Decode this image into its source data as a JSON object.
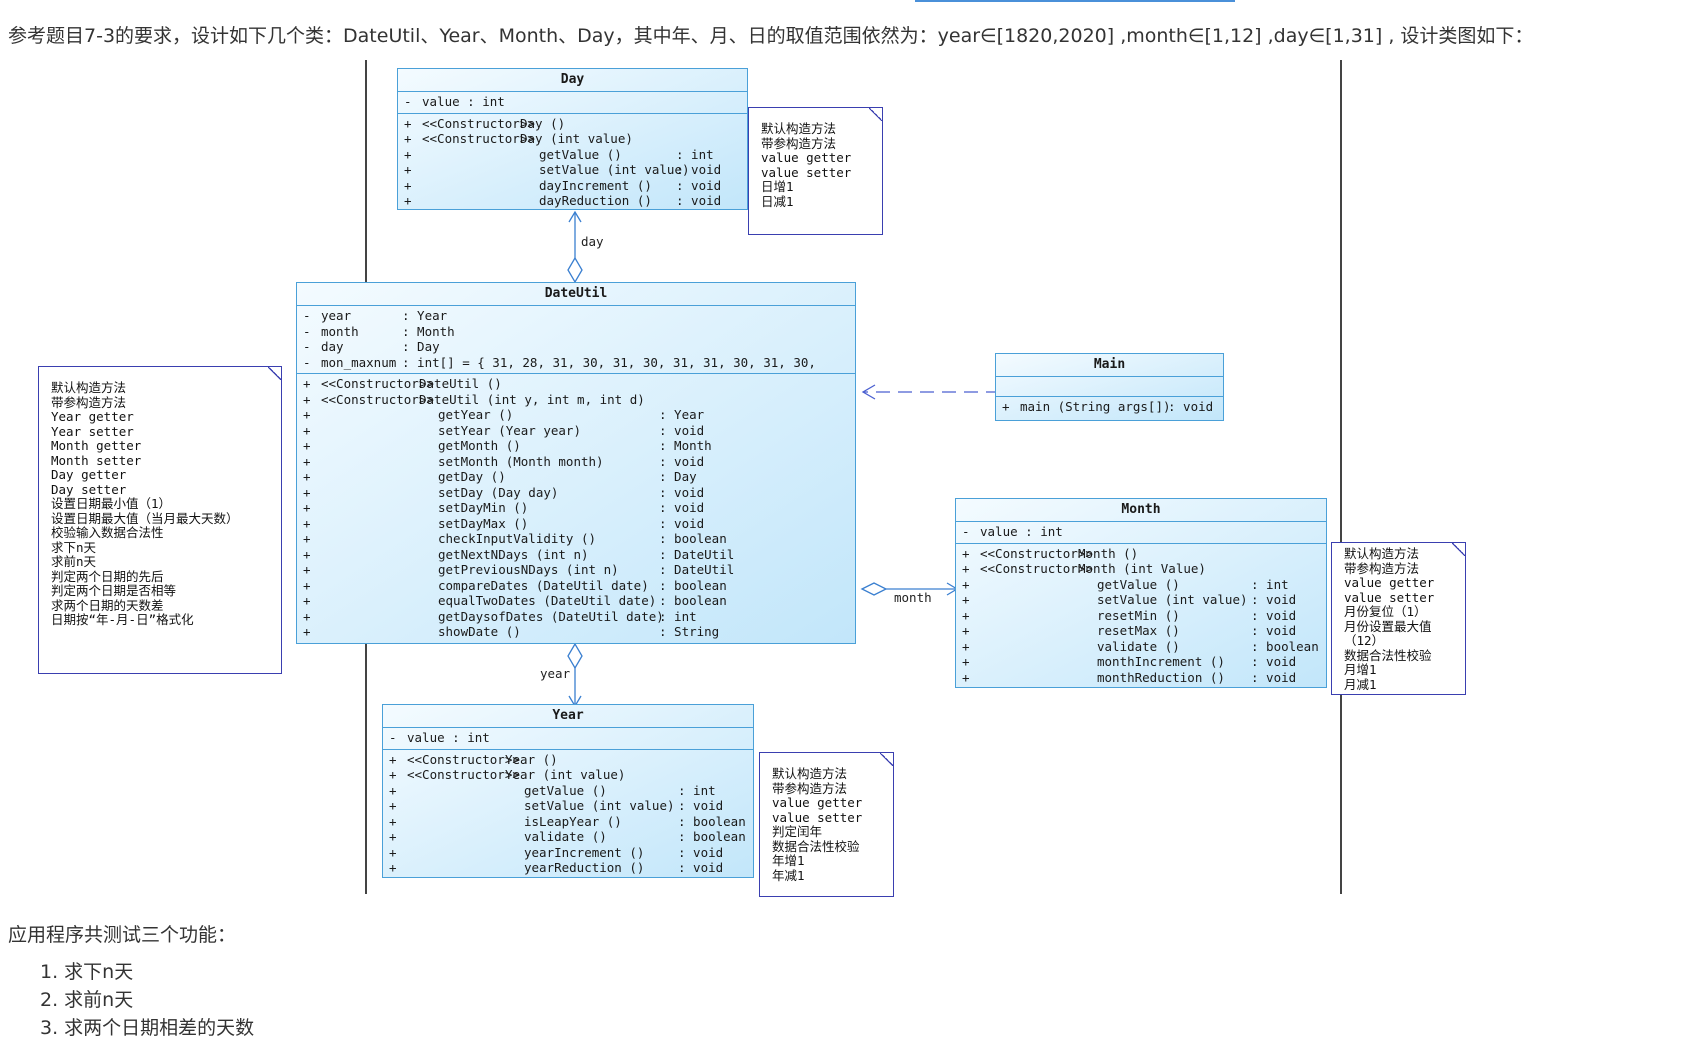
{
  "intro": "参考题目7-3的要求，设计如下几个类：DateUtil、Year、Month、Day，其中年、月、日的取值范围依然为：year∈[1820,2020] ,month∈[1,12] ,day∈[1,31] , 设计类图如下：",
  "classes": {
    "day": {
      "title": "Day",
      "attrs": [
        {
          "vis": "-",
          "name": "value : int"
        }
      ],
      "ops": [
        {
          "vis": "+",
          "stereo": "<<Constructor>>",
          "name": "Day ()",
          "type": ""
        },
        {
          "vis": "+",
          "stereo": "<<Constructor>>",
          "name": "Day (int value)",
          "type": ""
        },
        {
          "vis": "+",
          "stereo": "",
          "name": "getValue ()",
          "type": ": int"
        },
        {
          "vis": "+",
          "stereo": "",
          "name": "setValue (int value)",
          "type": ": void"
        },
        {
          "vis": "+",
          "stereo": "",
          "name": "dayIncrement ()",
          "type": ": void"
        },
        {
          "vis": "+",
          "stereo": "",
          "name": "dayReduction ()",
          "type": ": void"
        }
      ]
    },
    "dateutil": {
      "title": "DateUtil",
      "attrs": [
        {
          "vis": "-",
          "name": "year",
          "type": ": Year"
        },
        {
          "vis": "-",
          "name": "month",
          "type": ": Month"
        },
        {
          "vis": "-",
          "name": "day",
          "type": ": Day"
        },
        {
          "vis": "-",
          "name": "mon_maxnum",
          "type": ": int[] = { 31, 28, 31, 30, 31, 30, 31, 31, 30, 31, 30,"
        }
      ],
      "ops": [
        {
          "vis": "+",
          "stereo": "<<Constructor>>",
          "name": "DateUtil ()",
          "type": ""
        },
        {
          "vis": "+",
          "stereo": "<<Constructor>>",
          "name": "DateUtil (int y, int m, int d)",
          "type": ""
        },
        {
          "vis": "+",
          "stereo": "",
          "name": "getYear ()",
          "type": ": Year"
        },
        {
          "vis": "+",
          "stereo": "",
          "name": "setYear (Year year)",
          "type": ": void"
        },
        {
          "vis": "+",
          "stereo": "",
          "name": "getMonth ()",
          "type": ": Month"
        },
        {
          "vis": "+",
          "stereo": "",
          "name": "setMonth (Month month)",
          "type": ": void"
        },
        {
          "vis": "+",
          "stereo": "",
          "name": "getDay ()",
          "type": ": Day"
        },
        {
          "vis": "+",
          "stereo": "",
          "name": "setDay (Day day)",
          "type": ": void"
        },
        {
          "vis": "+",
          "stereo": "",
          "name": "setDayMin ()",
          "type": ": void"
        },
        {
          "vis": "+",
          "stereo": "",
          "name": "setDayMax ()",
          "type": ": void"
        },
        {
          "vis": "+",
          "stereo": "",
          "name": "checkInputValidity ()",
          "type": ": boolean"
        },
        {
          "vis": "+",
          "stereo": "",
          "name": "getNextNDays (int n)",
          "type": ": DateUtil"
        },
        {
          "vis": "+",
          "stereo": "",
          "name": "getPreviousNDays (int n)",
          "type": ": DateUtil"
        },
        {
          "vis": "+",
          "stereo": "",
          "name": "compareDates (DateUtil date)",
          "type": ": boolean"
        },
        {
          "vis": "+",
          "stereo": "",
          "name": "equalTwoDates (DateUtil date)",
          "type": ": boolean"
        },
        {
          "vis": "+",
          "stereo": "",
          "name": "getDaysofDates (DateUtil date)",
          "type": ": int"
        },
        {
          "vis": "+",
          "stereo": "",
          "name": "showDate ()",
          "type": ": String"
        }
      ]
    },
    "main": {
      "title": "Main",
      "attrs": [],
      "ops": [
        {
          "vis": "+",
          "stereo": "",
          "name": "main (String args[])",
          "type": ": void"
        }
      ]
    },
    "month": {
      "title": "Month",
      "attrs": [
        {
          "vis": "-",
          "name": "value : int"
        }
      ],
      "ops": [
        {
          "vis": "+",
          "stereo": "<<Constructor>>",
          "name": "Month ()",
          "type": ""
        },
        {
          "vis": "+",
          "stereo": "<<Constructor>>",
          "name": "Month (int Value)",
          "type": ""
        },
        {
          "vis": "+",
          "stereo": "",
          "name": "getValue ()",
          "type": ": int"
        },
        {
          "vis": "+",
          "stereo": "",
          "name": "setValue (int value)",
          "type": ": void"
        },
        {
          "vis": "+",
          "stereo": "",
          "name": "resetMin ()",
          "type": ": void"
        },
        {
          "vis": "+",
          "stereo": "",
          "name": "resetMax ()",
          "type": ": void"
        },
        {
          "vis": "+",
          "stereo": "",
          "name": "validate ()",
          "type": ": boolean"
        },
        {
          "vis": "+",
          "stereo": "",
          "name": "monthIncrement ()",
          "type": ": void"
        },
        {
          "vis": "+",
          "stereo": "",
          "name": "monthReduction ()",
          "type": ": void"
        }
      ]
    },
    "year": {
      "title": "Year",
      "attrs": [
        {
          "vis": "-",
          "name": "value : int"
        }
      ],
      "ops": [
        {
          "vis": "+",
          "stereo": "<<Constructor>>",
          "name": "Year ()",
          "type": ""
        },
        {
          "vis": "+",
          "stereo": "<<Constructor>>",
          "name": "Year (int value)",
          "type": ""
        },
        {
          "vis": "+",
          "stereo": "",
          "name": "getValue ()",
          "type": ": int"
        },
        {
          "vis": "+",
          "stereo": "",
          "name": "setValue (int value)",
          "type": ": void"
        },
        {
          "vis": "+",
          "stereo": "",
          "name": "isLeapYear ()",
          "type": ": boolean"
        },
        {
          "vis": "+",
          "stereo": "",
          "name": "validate ()",
          "type": ": boolean"
        },
        {
          "vis": "+",
          "stereo": "",
          "name": "yearIncrement ()",
          "type": ": void"
        },
        {
          "vis": "+",
          "stereo": "",
          "name": "yearReduction ()",
          "type": ": void"
        }
      ]
    }
  },
  "notes": {
    "day": [
      "默认构造方法",
      "带参构造方法",
      "value getter",
      "value setter",
      "日增1",
      "日减1"
    ],
    "dateutil": [
      "默认构造方法",
      "带参构造方法",
      "Year getter",
      "Year setter",
      "Month getter",
      "Month setter",
      "Day getter",
      "Day setter",
      "设置日期最小值（1）",
      "设置日期最大值（当月最大天数）",
      "校验输入数据合法性",
      "求下n天",
      "求前n天",
      "判定两个日期的先后",
      "判定两个日期是否相等",
      "求两个日期的天数差",
      "日期按“年-月-日”格式化"
    ],
    "month": [
      "默认构造方法",
      "带参构造方法",
      "value getter",
      "value setter",
      "月份复位（1）",
      "月份设置最大值",
      "（12）",
      "数据合法性校验",
      "月增1",
      "月减1"
    ],
    "year": [
      "默认构造方法",
      "带参构造方法",
      "value getter",
      "value setter",
      "判定闰年",
      "数据合法性校验",
      "年增1",
      "年减1"
    ]
  },
  "connectors": {
    "day": "day",
    "month": "month",
    "year": "year"
  },
  "outro": "应用程序共测试三个功能：",
  "list": [
    "1. 求下n天",
    "2. 求前n天",
    "3. 求两个日期相差的天数"
  ]
}
